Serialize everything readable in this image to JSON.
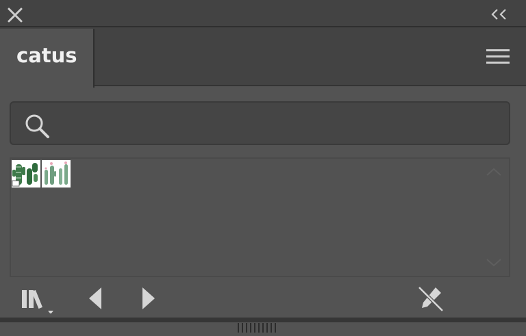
{
  "panel": {
    "active_tab": "catus"
  },
  "icons": {
    "close": "close-icon",
    "collapse": "double-chevron-left-icon",
    "menu": "hamburger-menu-icon",
    "search": "search-icon",
    "library": "library-books-icon",
    "previous": "triangle-left-icon",
    "next": "triangle-right-icon",
    "unlink": "pencil-unlink-icon"
  },
  "colors": {
    "panel_bg": "#535353",
    "header_bg": "#434343",
    "icon_light": "#d6d6d6",
    "cactus_green": "#3e7a4a"
  },
  "search": {
    "value": "",
    "placeholder": ""
  },
  "thumbnails": [
    {
      "name": "cactus-thumbnail-1"
    },
    {
      "name": "cactus-thumbnail-2"
    }
  ]
}
